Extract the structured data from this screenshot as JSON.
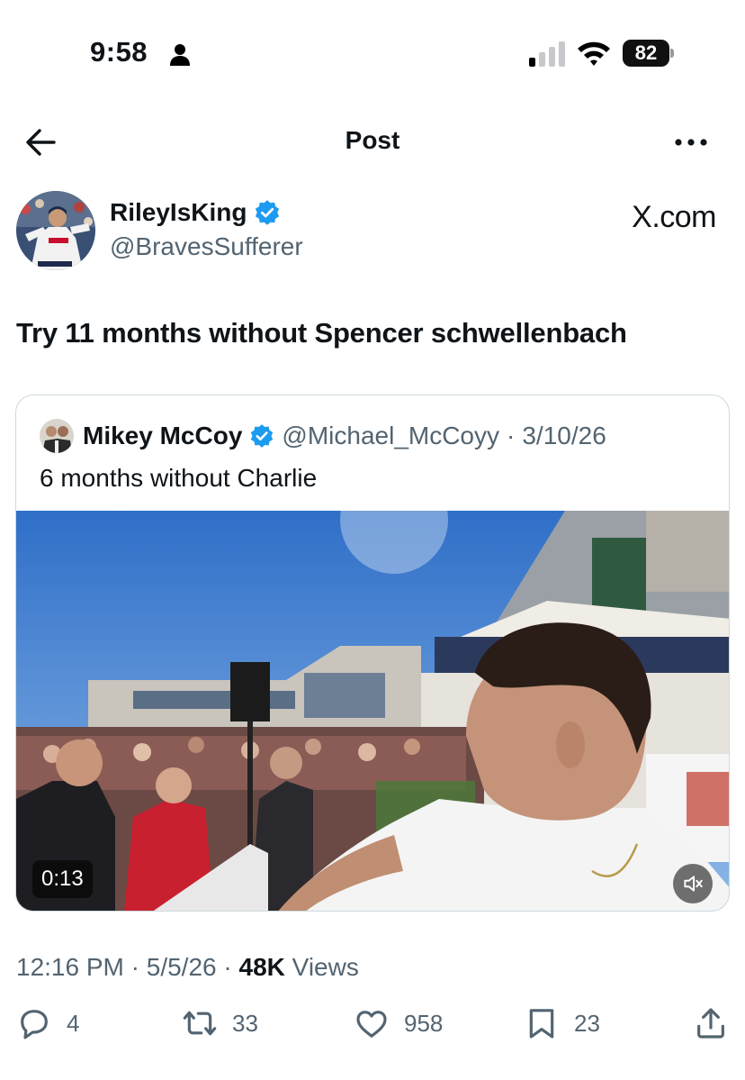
{
  "status_bar": {
    "time": "9:58",
    "battery": "82"
  },
  "nav": {
    "title": "Post"
  },
  "post": {
    "author_name": "RileyIsKing",
    "author_handle": "@BravesSufferer",
    "watermark": "X.com",
    "text": "Try 11 months without Spencer schwellenbach",
    "time": "12:16 PM",
    "date": "5/5/26",
    "views_count": "48K",
    "views_label": "Views",
    "separator": "·"
  },
  "quote": {
    "author_name": "Mikey McCoy",
    "author_handle": "@Michael_McCoyy",
    "separator": "·",
    "date": "3/10/26",
    "text": "6 months without Charlie",
    "video_duration": "0:13"
  },
  "actions": {
    "replies": "4",
    "reposts": "33",
    "likes": "958",
    "bookmarks": "23"
  },
  "colors": {
    "accent_blue": "#1d9bf0",
    "secondary_text": "#536471",
    "primary_text": "#0f1419",
    "border": "#cfd9de"
  },
  "icons": [
    "person-icon",
    "signal-icon",
    "wifi-icon",
    "back-arrow-icon",
    "more-icon",
    "verified-badge-icon",
    "speaker-icon",
    "reply-icon",
    "repost-icon",
    "like-icon",
    "bookmark-icon",
    "share-icon"
  ]
}
